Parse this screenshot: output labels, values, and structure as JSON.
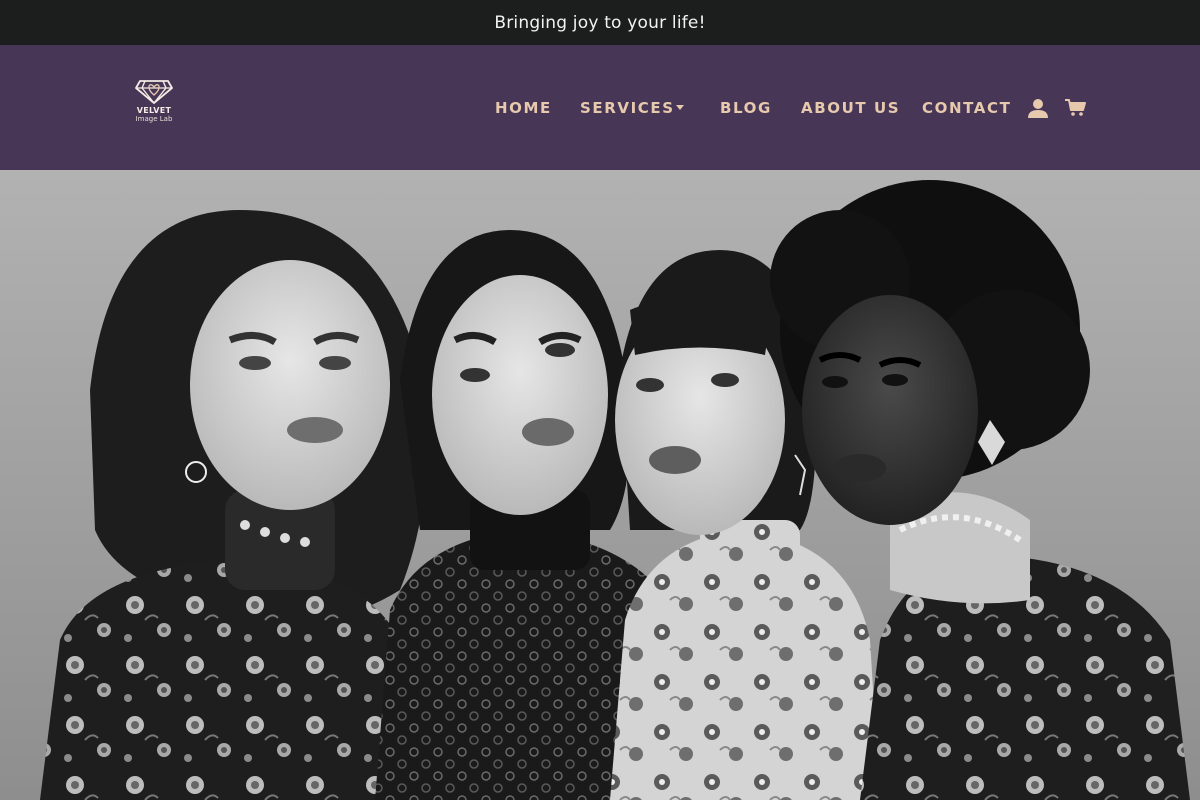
{
  "announcement": {
    "text": "Bringing joy to your life!"
  },
  "brand": {
    "name": "VELVET",
    "subtitle": "Image Lab",
    "logo_icon": "diamond-heart-logo-icon",
    "accent_color": "#e7c9ae",
    "header_bg": "#483656",
    "bar_bg": "#1c1e1e"
  },
  "nav": {
    "items": [
      {
        "label": "HOME"
      },
      {
        "label": "SERVICES",
        "has_dropdown": true
      },
      {
        "label": "BLOG"
      },
      {
        "label": "ABOUT US"
      },
      {
        "label": "CONTACT"
      }
    ],
    "account_icon": "user-icon",
    "cart_icon": "cart-icon"
  },
  "hero": {
    "image_icon": "hero-image",
    "style": "black-and-white"
  }
}
